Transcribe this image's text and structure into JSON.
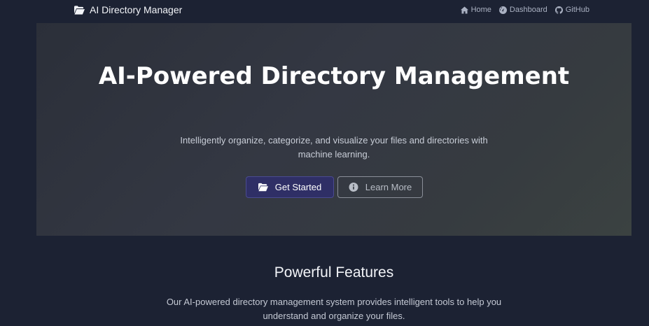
{
  "navbar": {
    "brand_label": "AI Directory Manager",
    "brand_icon": "folder-open-icon",
    "links": [
      {
        "label": "Home",
        "icon": "home-icon"
      },
      {
        "label": "Dashboard",
        "icon": "dashboard-icon"
      },
      {
        "label": "GitHub",
        "icon": "github-icon"
      }
    ]
  },
  "hero": {
    "title": "AI-Powered Directory Management",
    "subtitle": "Intelligently organize, categorize, and visualize your files and directories with machine learning.",
    "primary_button": {
      "label": "Get Started",
      "icon": "folder-open-icon"
    },
    "secondary_button": {
      "label": "Learn More",
      "icon": "info-circle-icon"
    }
  },
  "features": {
    "title": "Powerful Features",
    "description": "Our AI-powered directory management system provides intelligent tools to help you understand and organize your files."
  },
  "colors": {
    "background": "#1c2233",
    "primary_button": "#2f2f66",
    "hero_gradient_start": "#2b2f39",
    "hero_gradient_end": "#3b4241"
  }
}
